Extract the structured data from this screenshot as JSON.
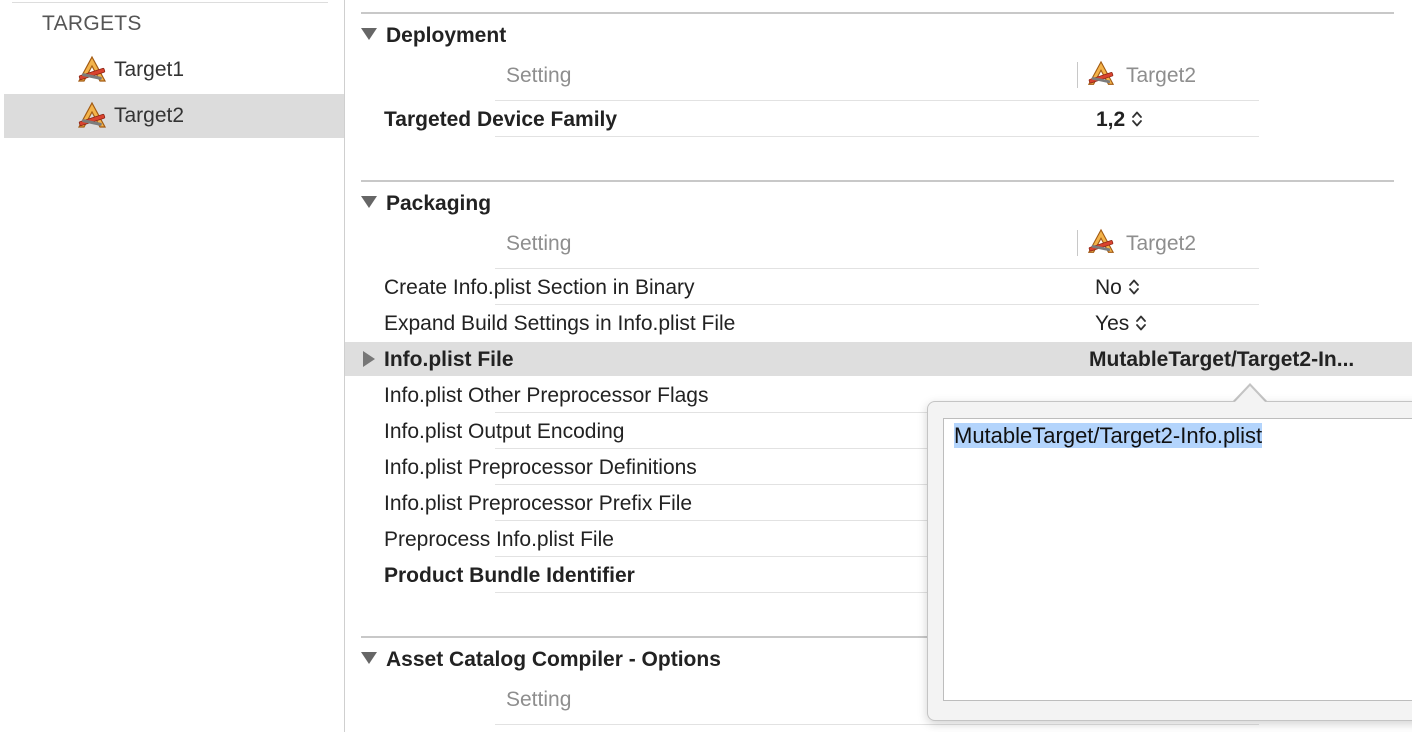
{
  "sidebar": {
    "heading": "TARGETS",
    "items": [
      {
        "label": "Target1",
        "selected": false
      },
      {
        "label": "Target2",
        "selected": true
      }
    ]
  },
  "columns": {
    "setting": "Setting",
    "target": "Target2"
  },
  "sections": {
    "deployment": {
      "title": "Deployment",
      "rows": [
        {
          "label": "Targeted Device Family",
          "value": "1,2"
        }
      ]
    },
    "packaging": {
      "title": "Packaging",
      "rows": [
        {
          "label": "Create Info.plist Section in Binary",
          "value": "No"
        },
        {
          "label": "Expand Build Settings in Info.plist File",
          "value": "Yes"
        },
        {
          "label": "Info.plist File",
          "value": "MutableTarget/Target2-In..."
        },
        {
          "label": "Info.plist Other Preprocessor Flags",
          "value": ""
        },
        {
          "label": "Info.plist Output Encoding",
          "value": ""
        },
        {
          "label": "Info.plist Preprocessor Definitions",
          "value": ""
        },
        {
          "label": "Info.plist Preprocessor Prefix File",
          "value": ""
        },
        {
          "label": "Preprocess Info.plist File",
          "value": ""
        },
        {
          "label": "Product Bundle Identifier",
          "value": ""
        }
      ]
    },
    "asset_catalog": {
      "title": "Asset Catalog Compiler - Options"
    }
  },
  "popover": {
    "text": "MutableTarget/Target2-Info.plist"
  },
  "icons": {
    "target": "xcode-target-icon",
    "stepper": "up-down-stepper-icon",
    "disclosure": "disclosure-triangle-icon"
  },
  "colors": {
    "selection": "#dcdcdc",
    "text_selection": "#b3d4fc",
    "icon_orange": "#e8a33b"
  }
}
